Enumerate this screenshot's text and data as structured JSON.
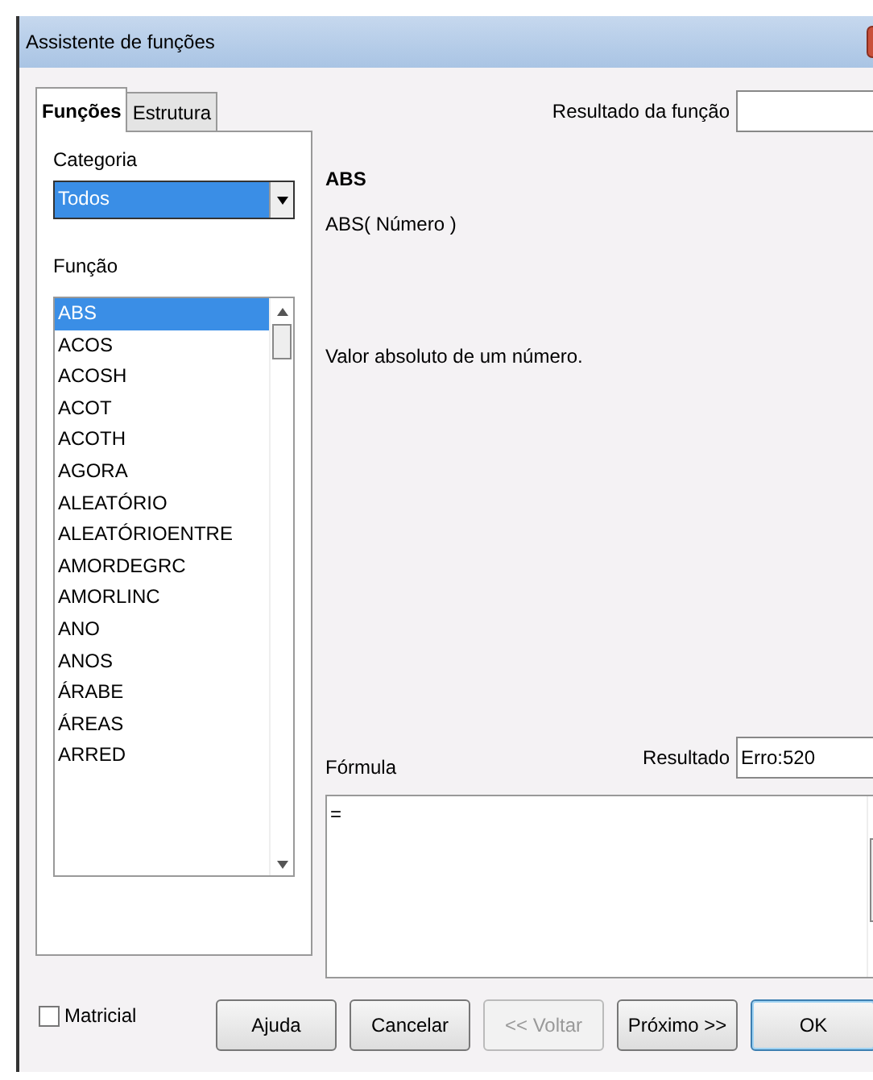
{
  "window": {
    "title": "Assistente de funções"
  },
  "tabs": [
    {
      "label": "Funções",
      "selected": true
    },
    {
      "label": "Estrutura",
      "selected": false
    }
  ],
  "category": {
    "label": "Categoria",
    "value": "Todos"
  },
  "function_list": {
    "label": "Função",
    "items": [
      {
        "label": "ABS",
        "selected": true
      },
      {
        "label": "ACOS",
        "selected": false
      },
      {
        "label": "ACOSH",
        "selected": false
      },
      {
        "label": "ACOT",
        "selected": false
      },
      {
        "label": "ACOTH",
        "selected": false
      },
      {
        "label": "AGORA",
        "selected": false
      },
      {
        "label": "ALEATÓRIO",
        "selected": false
      },
      {
        "label": "ALEATÓRIOENTRE",
        "selected": false
      },
      {
        "label": "AMORDEGRC",
        "selected": false
      },
      {
        "label": "AMORLINC",
        "selected": false
      },
      {
        "label": "ANO",
        "selected": false
      },
      {
        "label": "ANOS",
        "selected": false
      },
      {
        "label": "ÁRABE",
        "selected": false
      },
      {
        "label": "ÁREAS",
        "selected": false
      },
      {
        "label": "ARRED",
        "selected": false
      }
    ]
  },
  "function_result": {
    "label": "Resultado da função"
  },
  "details": {
    "name": "ABS",
    "syntax": "ABS( Número )",
    "description": "Valor absoluto de um número."
  },
  "formula": {
    "label": "Fórmula",
    "value": "=",
    "result_label": "Resultado",
    "result_value": "Erro:520"
  },
  "matricial": {
    "label": "Matricial",
    "checked": false
  },
  "buttons": [
    {
      "label": "Ajuda",
      "disabled": false,
      "default": false
    },
    {
      "label": "Cancelar",
      "disabled": false,
      "default": false
    },
    {
      "label": "<< Voltar",
      "disabled": true,
      "default": false
    },
    {
      "label": "Próximo >>",
      "disabled": false,
      "default": false
    },
    {
      "label": "OK",
      "disabled": false,
      "default": true
    }
  ]
}
